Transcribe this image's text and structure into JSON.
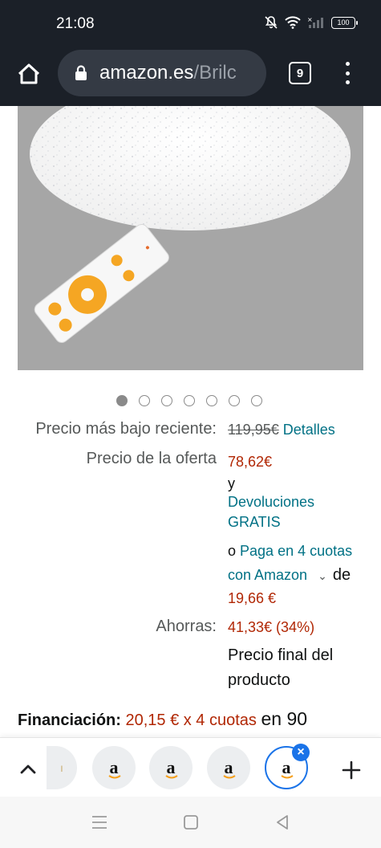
{
  "status_bar": {
    "time": "21:08",
    "battery": "100",
    "icons": [
      "mute-icon",
      "wifi-icon",
      "signal-icon",
      "battery-icon"
    ]
  },
  "browser": {
    "url_host": "amazon.es",
    "url_path": "/Brilc",
    "tab_count": "9"
  },
  "product": {
    "image_alt": "LED ceiling lamp with starry effect and remote control",
    "carousel": {
      "total": 7,
      "active": 1
    }
  },
  "pricing": {
    "recent_low_label": "Precio más bajo reciente:",
    "recent_low_value": "119,95€",
    "details_link": "Detalles",
    "offer_label": "Precio de la oferta",
    "offer_price": "78,62€",
    "and_word": "y",
    "returns_line1": "Devoluciones",
    "returns_line2": "GRATIS",
    "or_word": "o",
    "installments_link_1": "Paga en 4 cuotas",
    "installments_link_2": "con Amazon",
    "of_word": "de",
    "installment_amount": "19,66 €",
    "savings_label": "Ahorras:",
    "savings_value": "41,33€ (34%)",
    "final_line1": "Precio final del",
    "final_line2": "producto"
  },
  "financing": {
    "label": "Financiación:",
    "value": "20,15 € x 4 cuotas",
    "suffix": "en 90"
  },
  "tab_strip": {
    "tabs": [
      "a",
      "a",
      "a",
      "a"
    ]
  },
  "colors": {
    "toolbar": "#1b2028",
    "link": "#007185",
    "price": "#b12704",
    "accent": "#1a73e8"
  }
}
